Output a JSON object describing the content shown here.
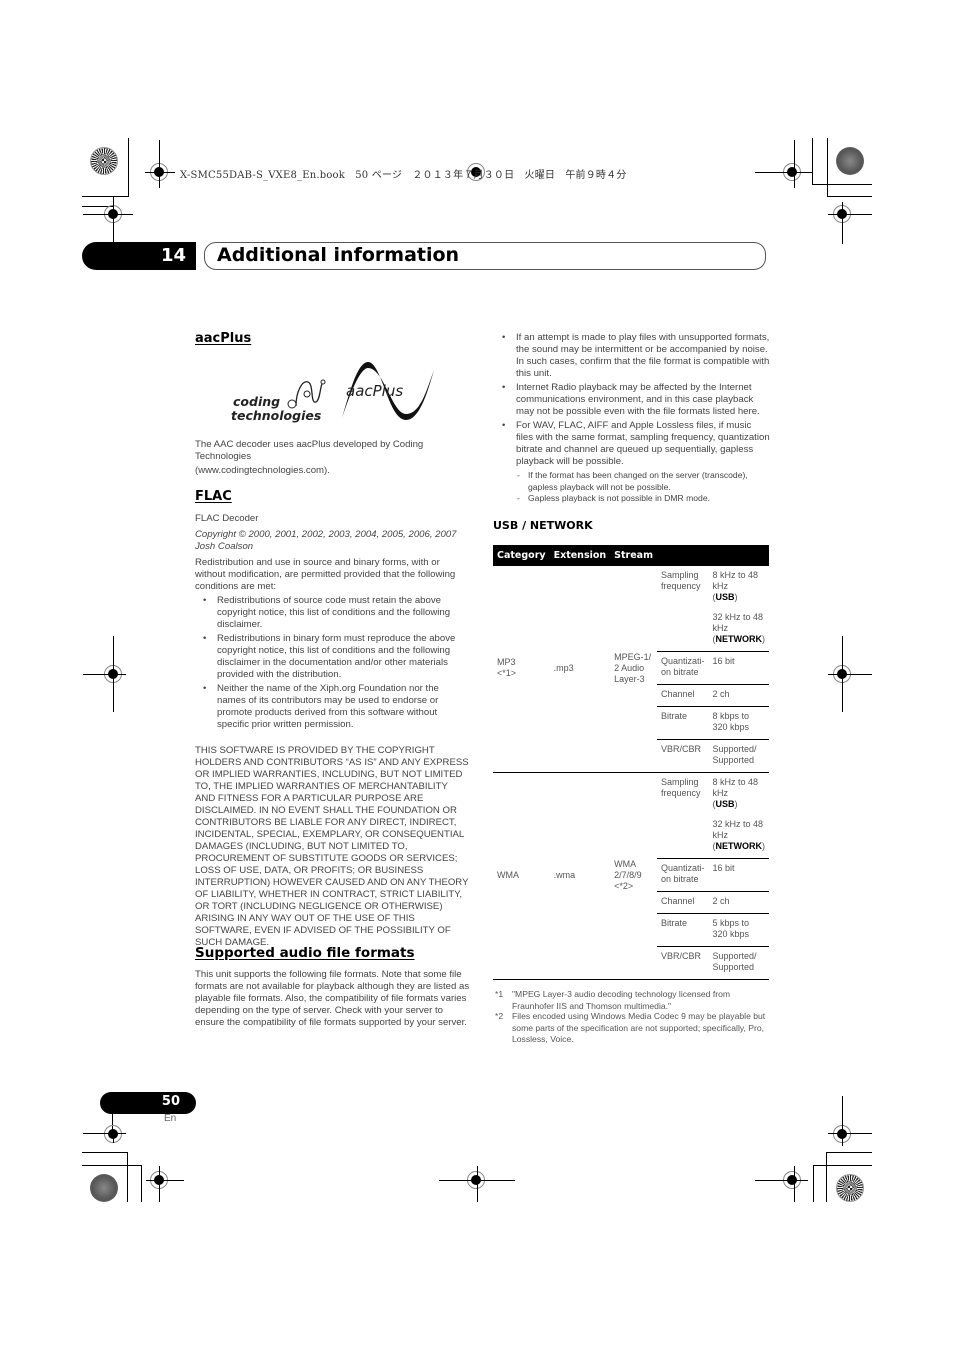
{
  "print_header": "X-SMC55DAB-S_VXE8_En.book　50 ページ　２０１３年７月３０日　火曜日　午前９時４分",
  "chapter": {
    "number": "14",
    "title": "Additional information"
  },
  "aacplus": {
    "heading": "aacPlus",
    "logo_left_line1": "coding",
    "logo_left_line2": "technologies",
    "logo_right": "aacPlus",
    "text_line1": "The AAC decoder uses aacPlus developed by Coding Technologies",
    "text_line2": "(www.codingtechnologies.com)."
  },
  "flac": {
    "heading": "FLAC",
    "decoder": "FLAC Decoder",
    "copyright": "Copyright © 2000, 2001, 2002, 2003, 2004, 2005, 2006, 2007 Josh Coalson",
    "intro": "Redistribution and use in source and binary forms, with or without modification, are permitted provided that the following conditions are met:",
    "conditions": [
      "Redistributions of source code must retain the above copyright notice, this list of conditions and the following disclaimer.",
      "Redistributions in binary form must reproduce the above copyright notice, this list of conditions and the following disclaimer in the documentation and/or other materials provided with the distribution.",
      "Neither the name of the Xiph.org Foundation nor the names of its contributors may be used to endorse or promote products derived from this software without specific prior written permission."
    ],
    "disclaimer": "THIS SOFTWARE IS PROVIDED BY THE COPYRIGHT HOLDERS AND CONTRIBUTORS “AS IS” AND ANY EXPRESS OR IMPLIED WARRANTIES, INCLUDING, BUT NOT LIMITED TO, THE IMPLIED WARRANTIES OF MERCHANTABILITY AND FITNESS FOR A PARTICULAR PURPOSE ARE DISCLAIMED. IN NO EVENT SHALL THE FOUNDATION OR CONTRIBUTORS BE LIABLE FOR ANY DIRECT, INDIRECT, INCIDENTAL, SPECIAL, EXEMPLARY, OR CONSEQUENTIAL DAMAGES (INCLUDING, BUT NOT LIMITED TO, PROCUREMENT OF SUBSTITUTE GOODS OR SERVICES; LOSS OF USE, DATA, OR PROFITS; OR BUSINESS INTERRUPTION) HOWEVER CAUSED AND ON ANY THEORY OF LIABILITY, WHETHER IN CONTRACT, STRICT LIABILITY, OR TORT (INCLUDING NEGLIGENCE OR OTHERWISE) ARISING IN ANY WAY OUT OF THE USE OF THIS SOFTWARE, EVEN IF ADVISED OF THE POSSIBILITY OF SUCH DAMAGE."
  },
  "supported": {
    "heading": "Supported audio file formats",
    "text": "This unit supports the following file formats. Note that some file formats are not available for playback although they are listed as playable file formats. Also, the compatibility of file formats varies depending on the type of server. Check with your server to ensure the compatibility of file formats supported by your server."
  },
  "notes": {
    "bullets": [
      "If an attempt is made to play files with unsupported formats, the sound may be intermittent or be accompanied by noise. In such cases, confirm that the file format is compatible with this unit.",
      "Internet Radio playback may be affected by the Internet communications environment, and in this case playback may not be possible even with the file formats listed here.",
      "For WAV, FLAC, AIFF and Apple Lossless files, if music files with the same format, sampling frequency, quantization bitrate and channel are queued up sequentially, gapless playback will be possible."
    ],
    "subnotes": [
      "If the format has been changed on the server (transcode), gapless playback will not be possible.",
      "Gapless playback is not possible in DMR mode."
    ]
  },
  "usb_network": {
    "heading": "USB / NETWORK",
    "columns": [
      "Category",
      "Extension",
      "Stream"
    ],
    "formats": [
      {
        "category": "MP3",
        "category_note": "<*1>",
        "extension": ".mp3",
        "stream": "MPEG-1/ 2 Audio Layer-3",
        "stream_note": "",
        "sampling_label": "Sampling frequency",
        "sampling_usb": "8 kHz to 48 kHz",
        "usb_tag": "USB",
        "sampling_net": "32 kHz to 48 kHz",
        "net_tag": "NETWORK",
        "quant_label": "Quantizati- on bitrate",
        "quant_value": "16 bit",
        "channel_label": "Channel",
        "channel_value": "2 ch",
        "bitrate_label": "Bitrate",
        "bitrate_value": "8 kbps to 320 kbps",
        "vbr_label": "VBR/CBR",
        "vbr_value": "Supported/ Supported"
      },
      {
        "category": "WMA",
        "category_note": "",
        "extension": ".wma",
        "stream": "WMA 2/7/8/9",
        "stream_note": "<*2>",
        "sampling_label": "Sampling frequency",
        "sampling_usb": "8 kHz to 48 kHz",
        "usb_tag": "USB",
        "sampling_net": "32 kHz to 48 kHz",
        "net_tag": "NETWORK",
        "quant_label": "Quantizati- on bitrate",
        "quant_value": "16 bit",
        "channel_label": "Channel",
        "channel_value": "2 ch",
        "bitrate_label": "Bitrate",
        "bitrate_value": "5 kbps to 320 kbps",
        "vbr_label": "VBR/CBR",
        "vbr_value": "Supported/ Supported"
      }
    ],
    "footnotes": [
      {
        "mark": "*1",
        "text": "\"MPEG Layer-3 audio decoding technology licensed from Fraunhofer IIS and Thomson multimedia.\""
      },
      {
        "mark": "*2",
        "text": "Files encoded using Windows Media Codec 9 may be playable but some parts of the specification are not supported; specifically, Pro, Lossless, Voice."
      }
    ]
  },
  "footer": {
    "page": "50",
    "lang": "En"
  }
}
